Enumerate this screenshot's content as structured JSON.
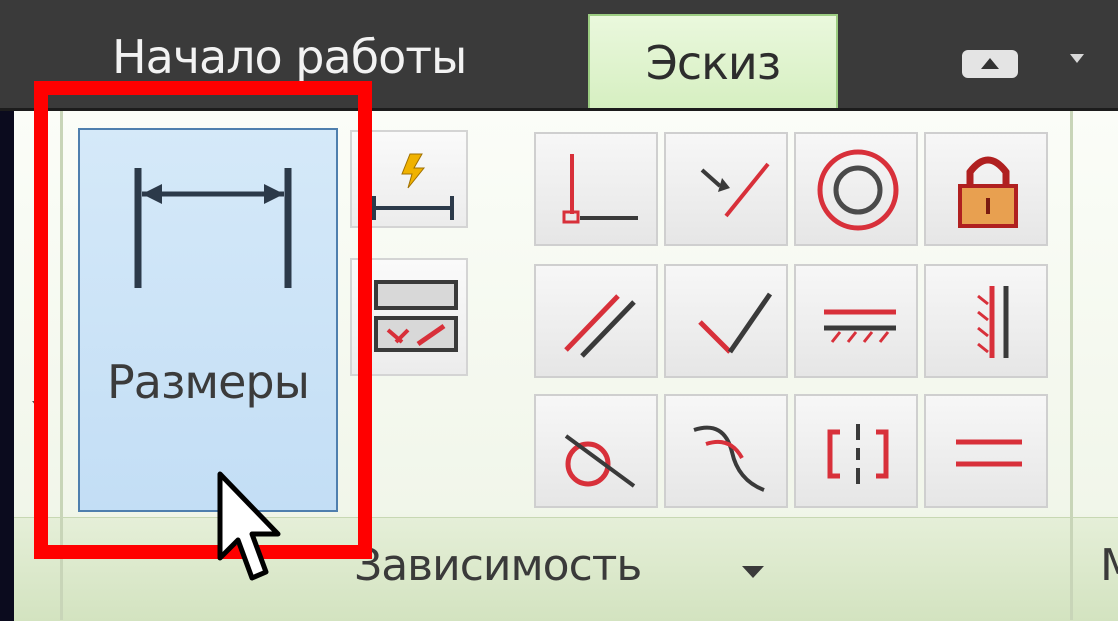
{
  "tabs": {
    "start_label": "Начало работы",
    "sketch_label": "Эскиз"
  },
  "dimension": {
    "label": "Размеры"
  },
  "constraint_panel": {
    "title": "Зависимость",
    "next_panel_initial": "М"
  },
  "icons": {
    "dimension": "dimension-icon",
    "auto_dimension": "auto-dimension-icon",
    "show_constraints": "show-constraints-icon",
    "constraints": [
      "coincident-icon",
      "collinear-icon",
      "concentric-icon",
      "fix-icon",
      "parallel-icon",
      "perpendicular-icon",
      "horizontal-icon",
      "vertical-icon",
      "tangent-icon",
      "smooth-icon",
      "symmetric-icon",
      "equal-icon"
    ]
  },
  "colors": {
    "highlight": "#ff0000",
    "active_tab": "#d6efc1",
    "selected_button": "#c3def5",
    "constraint_icon": "#d8303a"
  }
}
